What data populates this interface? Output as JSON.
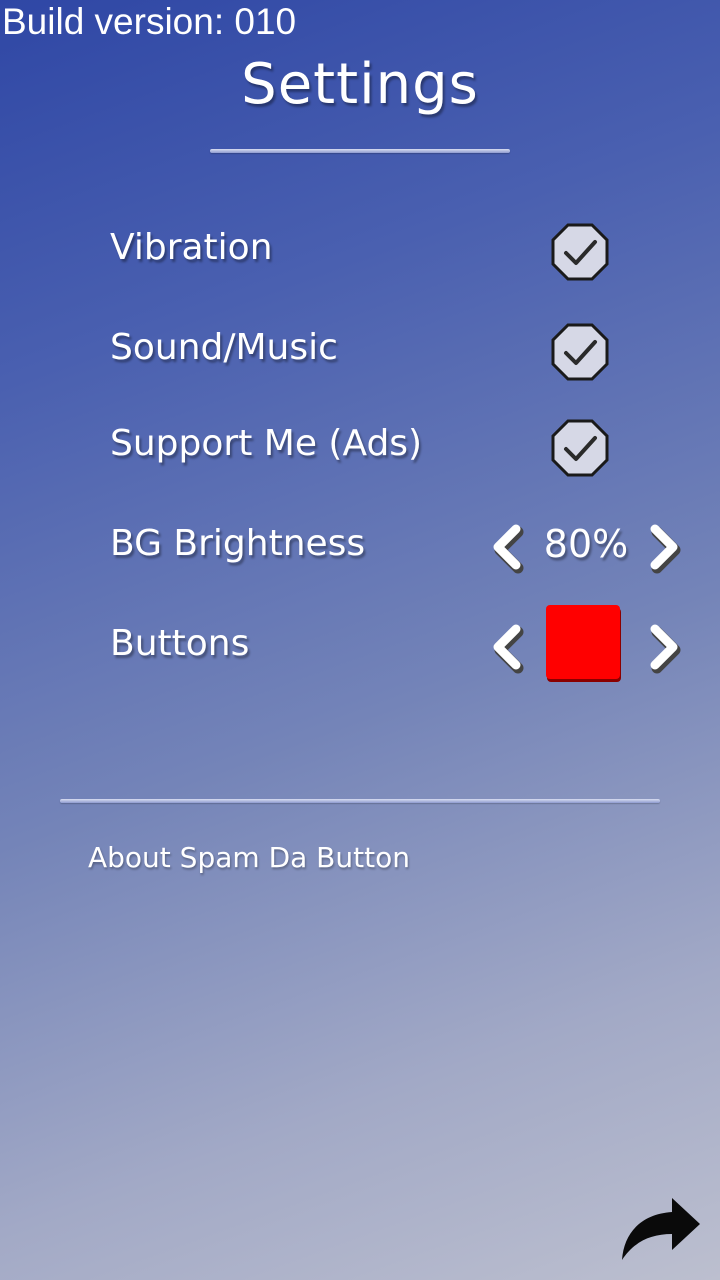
{
  "build_version": "Build version: 010",
  "title": "Settings",
  "settings": {
    "vibration": {
      "label": "Vibration",
      "checked": true
    },
    "sound_music": {
      "label": "Sound/Music",
      "checked": true
    },
    "support_ads": {
      "label": "Support Me (Ads)",
      "checked": true
    },
    "bg_brightness": {
      "label": "BG Brightness",
      "value": "80%"
    },
    "buttons": {
      "label": "Buttons",
      "color": "#ff0000"
    }
  },
  "about_link": "About Spam Da Button",
  "icons": {
    "checkbox": "check-icon",
    "prev": "chevron-left-icon",
    "next": "chevron-right-icon",
    "back": "share-arrow-icon"
  },
  "colors": {
    "checkbox_fill": "#d6d8e6",
    "button_color": "#ff0000"
  }
}
